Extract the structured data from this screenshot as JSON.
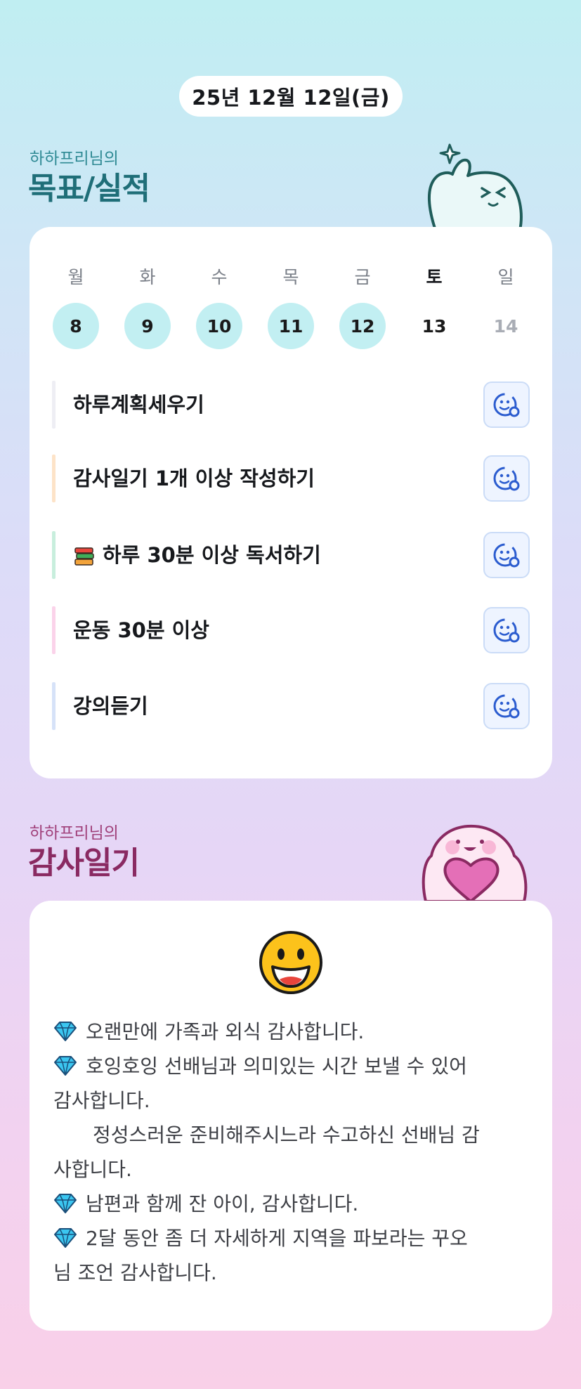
{
  "date_label": "25년 12월 12일(금)",
  "goals_section": {
    "subtitle": "하하프리님의",
    "title": "목표/실적"
  },
  "gratitude_section": {
    "subtitle": "하하프리님의",
    "title": "감사일기"
  },
  "week": {
    "weekdays": [
      "월",
      "화",
      "수",
      "목",
      "금",
      "토",
      "일"
    ],
    "days": [
      {
        "num": "8",
        "state": "done"
      },
      {
        "num": "9",
        "state": "done"
      },
      {
        "num": "10",
        "state": "done"
      },
      {
        "num": "11",
        "state": "done"
      },
      {
        "num": "12",
        "state": "done"
      },
      {
        "num": "13",
        "state": "current"
      },
      {
        "num": "14",
        "state": "future"
      }
    ]
  },
  "goals": [
    {
      "label": "하루계획세우기",
      "bar_color": "#eeeef4",
      "icon": null
    },
    {
      "label": "감사일기 1개 이상 작성하기",
      "bar_color": "#fde3c8",
      "icon": null
    },
    {
      "label": "하루 30분 이상 독서하기",
      "bar_color": "#c8eedd",
      "icon": "books-emoji-icon"
    },
    {
      "label": "운동 30분 이상",
      "bar_color": "#fbd3ea",
      "icon": null
    },
    {
      "label": "강의듣기",
      "bar_color": "#d6e2f8",
      "icon": null
    }
  ],
  "gratitude": {
    "emoji": "grinning-face-icon",
    "lines": [
      {
        "gem": true,
        "text": "오랜만에 가족과 외식 감사합니다."
      },
      {
        "gem": true,
        "text": "호잉호잉 선배님과 의미있는 시간 보낼 수 있어"
      },
      {
        "gem": false,
        "text": "감사합니다."
      },
      {
        "gem": false,
        "indent": true,
        "text": "정성스러운 준비해주시느라 수고하신 선배님 감"
      },
      {
        "gem": false,
        "text": "사합니다."
      },
      {
        "gem": true,
        "text": "남편과 함께 잔 아이, 감사합니다."
      },
      {
        "gem": true,
        "text": "2달 동안 좀 더 자세하게 지역을 파보라는 꾸오"
      },
      {
        "gem": false,
        "text": "님 조언 감사합니다."
      }
    ]
  },
  "colors": {
    "goal_accent": "#1f6e78",
    "gratitude_accent": "#8a2a62",
    "done_day": "#c2eff2",
    "goal_button_bg": "#eef4ff",
    "goal_button_icon": "#2b5ccf"
  }
}
